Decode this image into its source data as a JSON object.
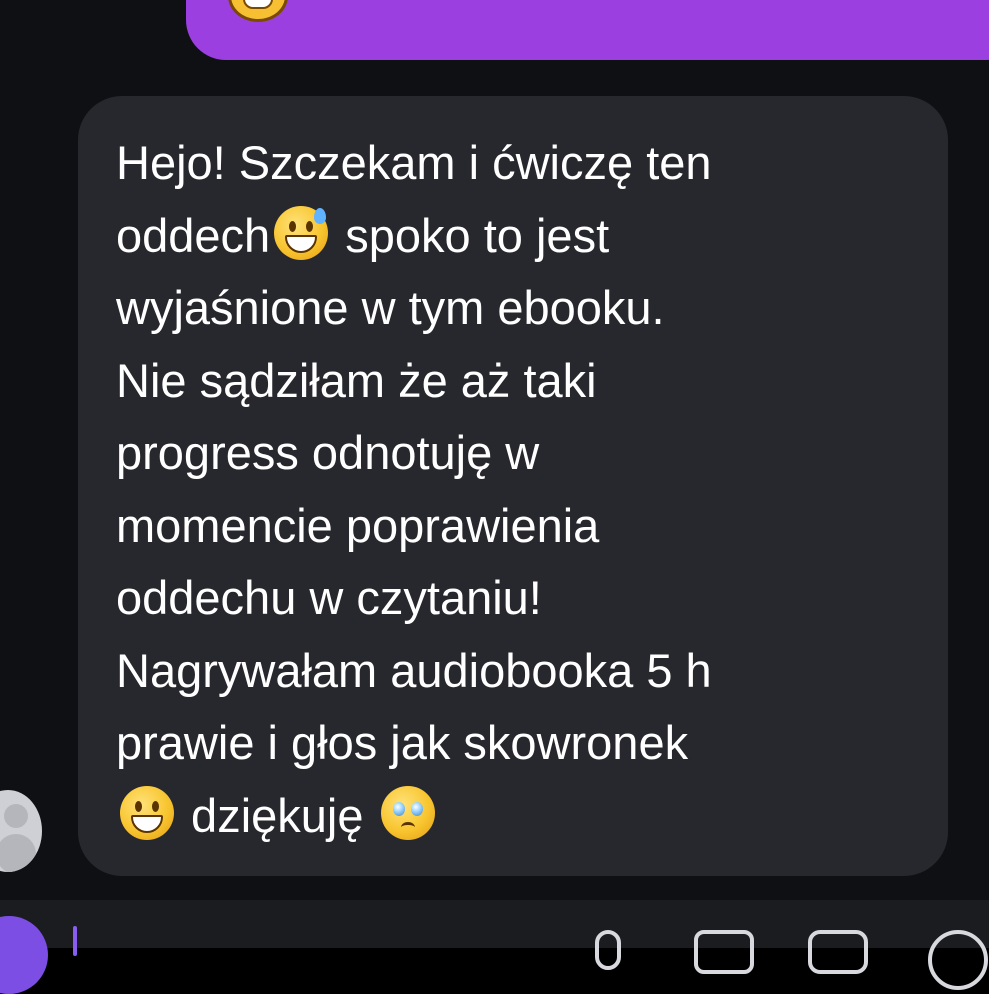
{
  "chat": {
    "outgoing_emoji": "grinning-face-icon",
    "incoming_message": {
      "lines": [
        "Hejo! Szczekam i ćwiczę ten",
        "oddech",
        " spoko to jest",
        "wyjaśnione w tym ebooku.",
        "Nie sądziłam że aż taki",
        "progress odnotuję w",
        "momencie poprawienia",
        "oddechu w czytaniu!",
        "Nagrywałam audiobooka 5 h",
        "prawie i głos jak skowronek",
        " dziękuję "
      ],
      "emojis": [
        "grinning-sweat-icon",
        "grinning-face-icon",
        "pleading-face-icon"
      ]
    },
    "sender_avatar": "user-avatar"
  },
  "composer": {
    "placeholder": "",
    "icons": [
      "attach-icon",
      "mic-icon",
      "image-icon",
      "sticker-icon",
      "emoji-icon"
    ]
  },
  "colors": {
    "background": "#0f1014",
    "incoming_bubble": "#27282d",
    "outgoing_bubble": "#9b3fe0",
    "accent": "#7c4ee4"
  }
}
